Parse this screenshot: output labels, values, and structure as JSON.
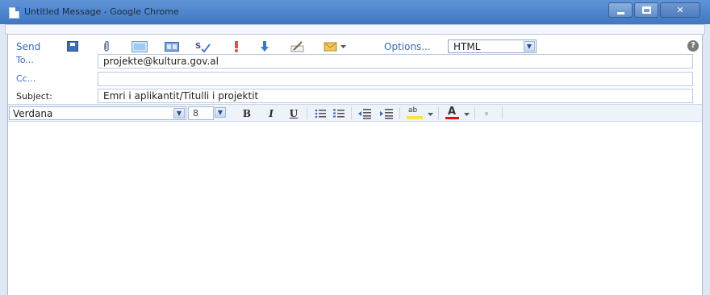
{
  "window": {
    "title": "Untitled Message - Google Chrome",
    "controls": {
      "minimize": "–",
      "maximize": "□",
      "close": "✕"
    }
  },
  "toolbar": {
    "send_label": "Send",
    "options_label": "Options...",
    "format_value": "HTML",
    "help": "?",
    "icons": [
      "save-icon",
      "attach-icon",
      "insert-image-icon",
      "address-book-icon",
      "spell-check-icon",
      "importance-high-icon",
      "importance-low-icon",
      "signature-icon",
      "insert-icon"
    ]
  },
  "headers": {
    "to_label": "To...",
    "to_value": "projekte@kultura.gov.al",
    "cc_label": "Cc...",
    "cc_value": "",
    "subject_label": "Subject:",
    "subject_value": "Emri i aplikantit/Titulli i projektit"
  },
  "format_bar": {
    "font": "Verdana",
    "size": "8",
    "bold": "B",
    "italic": "I",
    "underline": "U",
    "highlight": "ab",
    "font_color": "A",
    "more": "»"
  },
  "colors": {
    "titlebar": "#4a82cb",
    "label_blue": "#3b6ab2",
    "font_color_underline": "#d11"
  }
}
